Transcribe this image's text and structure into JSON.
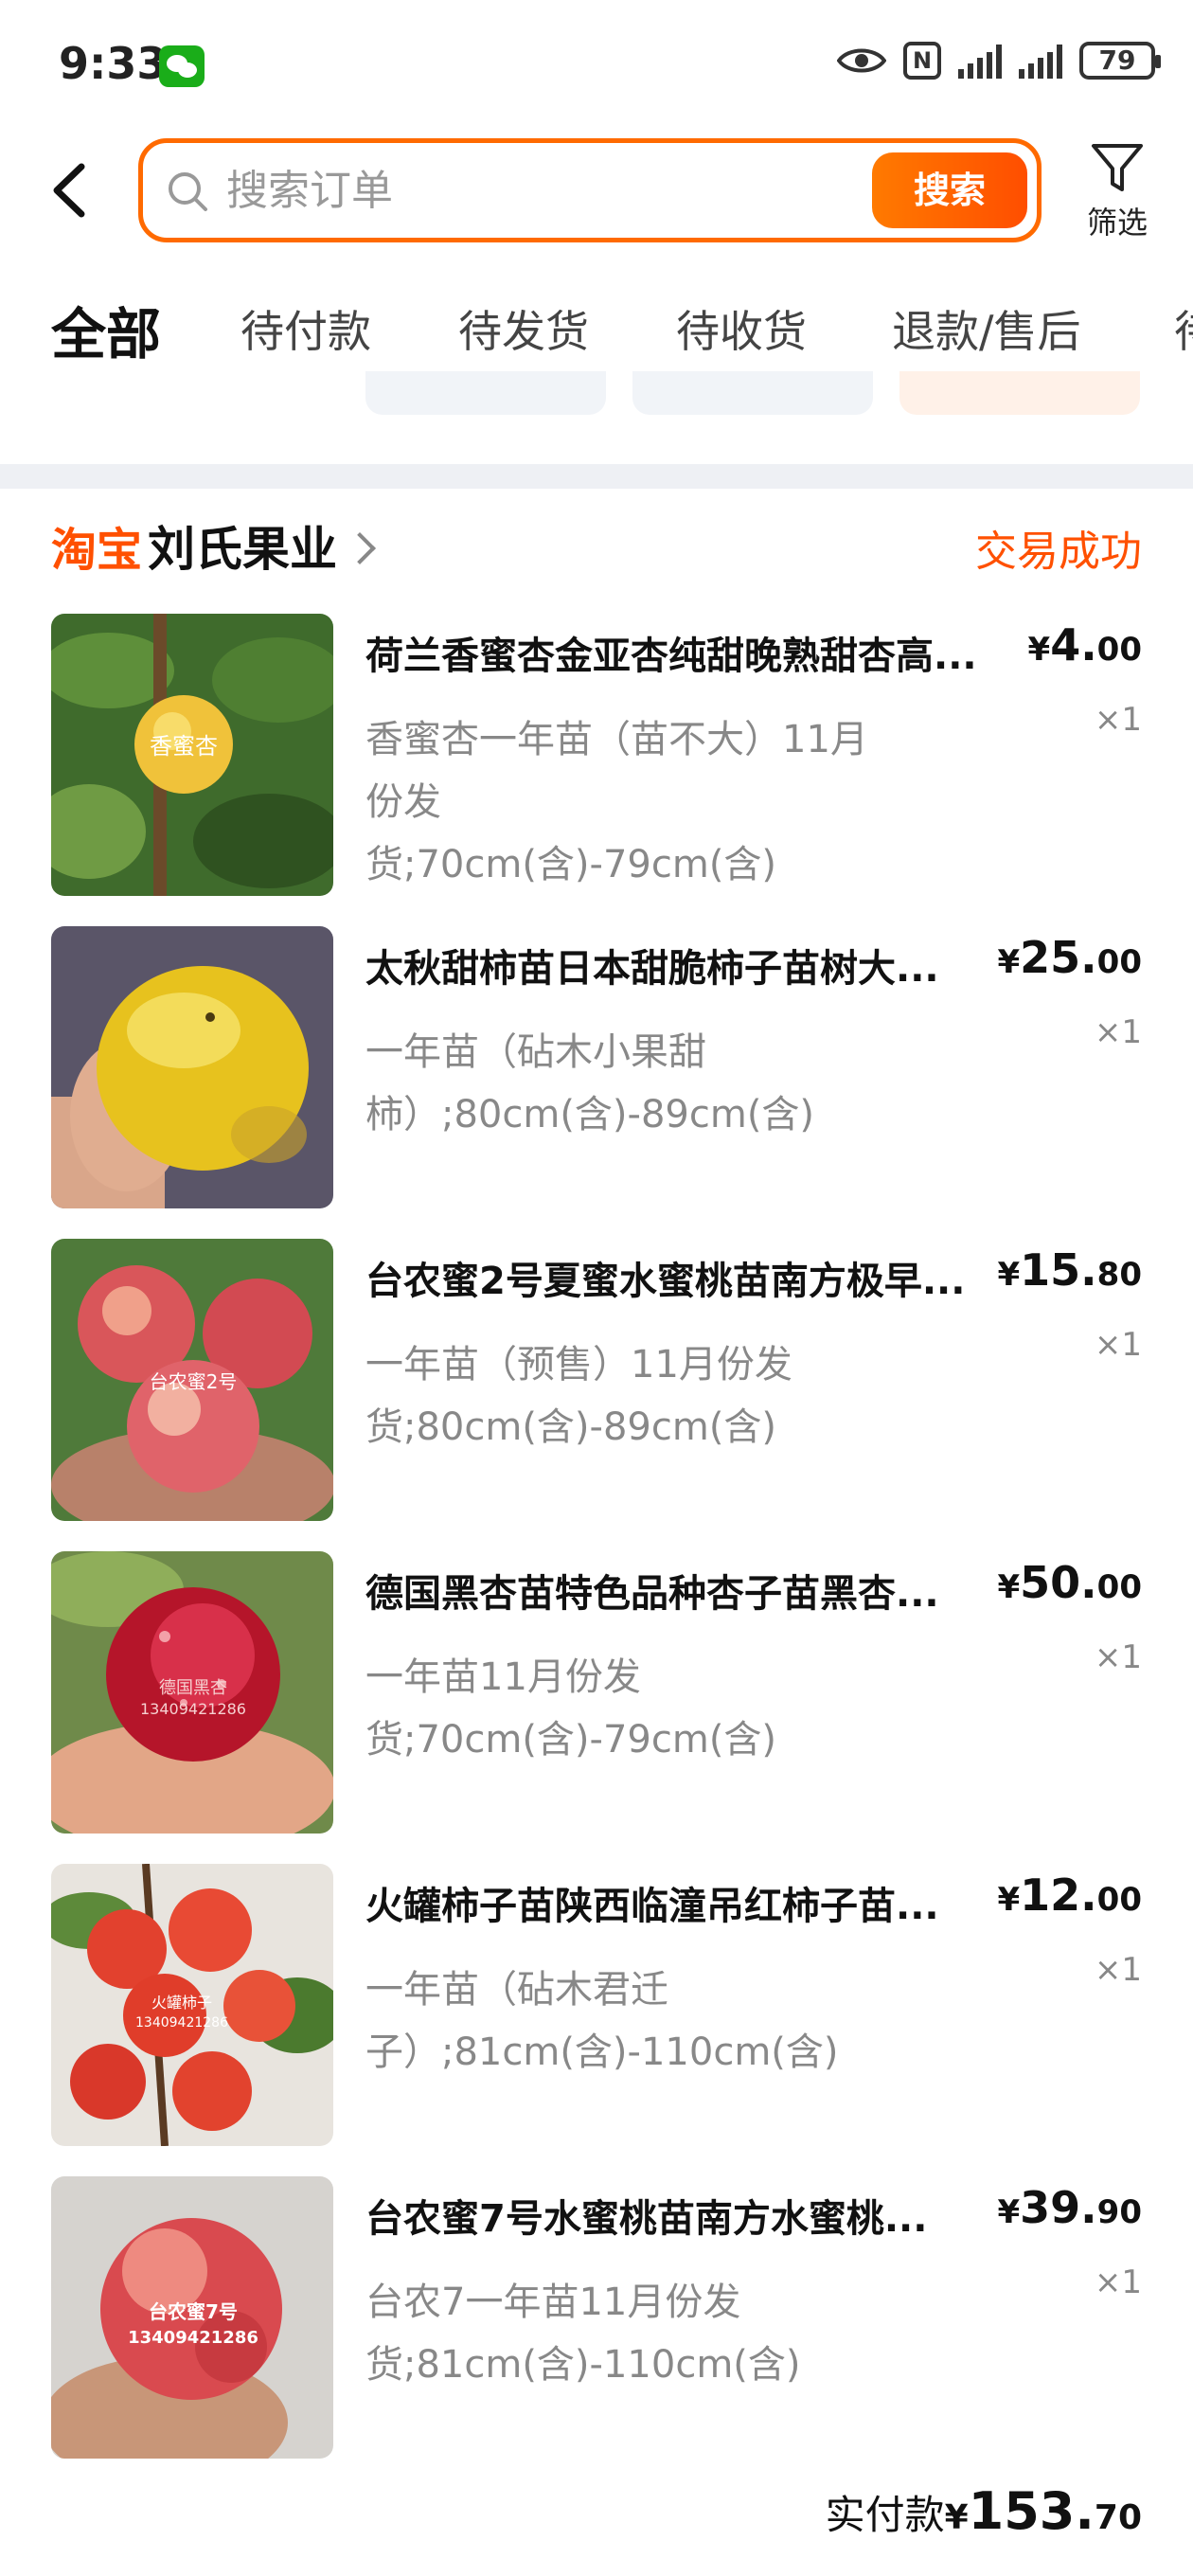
{
  "status_bar": {
    "time": "9:33",
    "nfc": "N",
    "battery": "79"
  },
  "search": {
    "placeholder": "搜索订单",
    "button_label": "搜索",
    "filter_label": "筛选"
  },
  "tabs": [
    {
      "label": "全部",
      "active": true
    },
    {
      "label": "待付款"
    },
    {
      "label": "待发货"
    },
    {
      "label": "待收货"
    },
    {
      "label": "退款/售后"
    },
    {
      "label": "待"
    }
  ],
  "order": {
    "platform": "淘宝",
    "shop_name": "刘氏果业",
    "status": "交易成功",
    "items": [
      {
        "title": "荷兰香蜜杏金亚杏纯甜晚熟甜杏高...",
        "spec_line1": "香蜜杏一年苗（苗不大）11月份发",
        "spec_line2": "货;70cm(含)-79cm(含)",
        "currency": "¥",
        "price_int": "4.",
        "price_dec": "00",
        "qty": "×1"
      },
      {
        "title": "太秋甜柿苗日本甜脆柿子苗树大...",
        "spec_line1": "一年苗（砧木小果甜",
        "spec_line2": "柿）;80cm(含)-89cm(含)",
        "currency": "¥",
        "price_int": "25.",
        "price_dec": "00",
        "qty": "×1"
      },
      {
        "title": "台农蜜2号夏蜜水蜜桃苗南方极早...",
        "spec_line1": "一年苗（预售）11月份发",
        "spec_line2": "货;80cm(含)-89cm(含)",
        "currency": "¥",
        "price_int": "15.",
        "price_dec": "80",
        "qty": "×1"
      },
      {
        "title": "德国黑杏苗特色品种杏子苗黑杏...",
        "spec_line1": "一年苗11月份发",
        "spec_line2": "货;70cm(含)-79cm(含)",
        "currency": "¥",
        "price_int": "50.",
        "price_dec": "00",
        "qty": "×1"
      },
      {
        "title": "火罐柿子苗陕西临潼吊红柿子苗...",
        "spec_line1": "一年苗（砧木君迁",
        "spec_line2": "子）;81cm(含)-110cm(含)",
        "currency": "¥",
        "price_int": "12.",
        "price_dec": "00",
        "qty": "×1"
      },
      {
        "title": "台农蜜7号水蜜桃苗南方水蜜桃...",
        "spec_line1": "台农7一年苗11月份发",
        "spec_line2": "货;81cm(含)-110cm(含)",
        "currency": "¥",
        "price_int": "39.",
        "price_dec": "90",
        "qty": "×1"
      }
    ],
    "total_label": "实付款",
    "total_currency": "¥",
    "total_int": "153.",
    "total_dec": "70"
  },
  "image_labels": {
    "apricot": "香蜜杏",
    "peach2": "台农蜜2号",
    "black_apricot_line1": "德国黑杏",
    "black_apricot_line2": "13409421286",
    "persimmon": "火罐柿子",
    "persimmon_phone": "13409421286",
    "peach7_line1": "台农蜜7号",
    "peach7_line2": "13409421286"
  },
  "colors": {
    "accent": "#ff5000",
    "search_border": "#ff6a00",
    "muted_text": "#888888"
  },
  "icons": [
    "wechat-icon",
    "eye-icon",
    "nfc-icon",
    "signal-icon",
    "battery-icon",
    "back-arrow-icon",
    "search-icon",
    "filter-icon",
    "chevron-right-icon"
  ]
}
